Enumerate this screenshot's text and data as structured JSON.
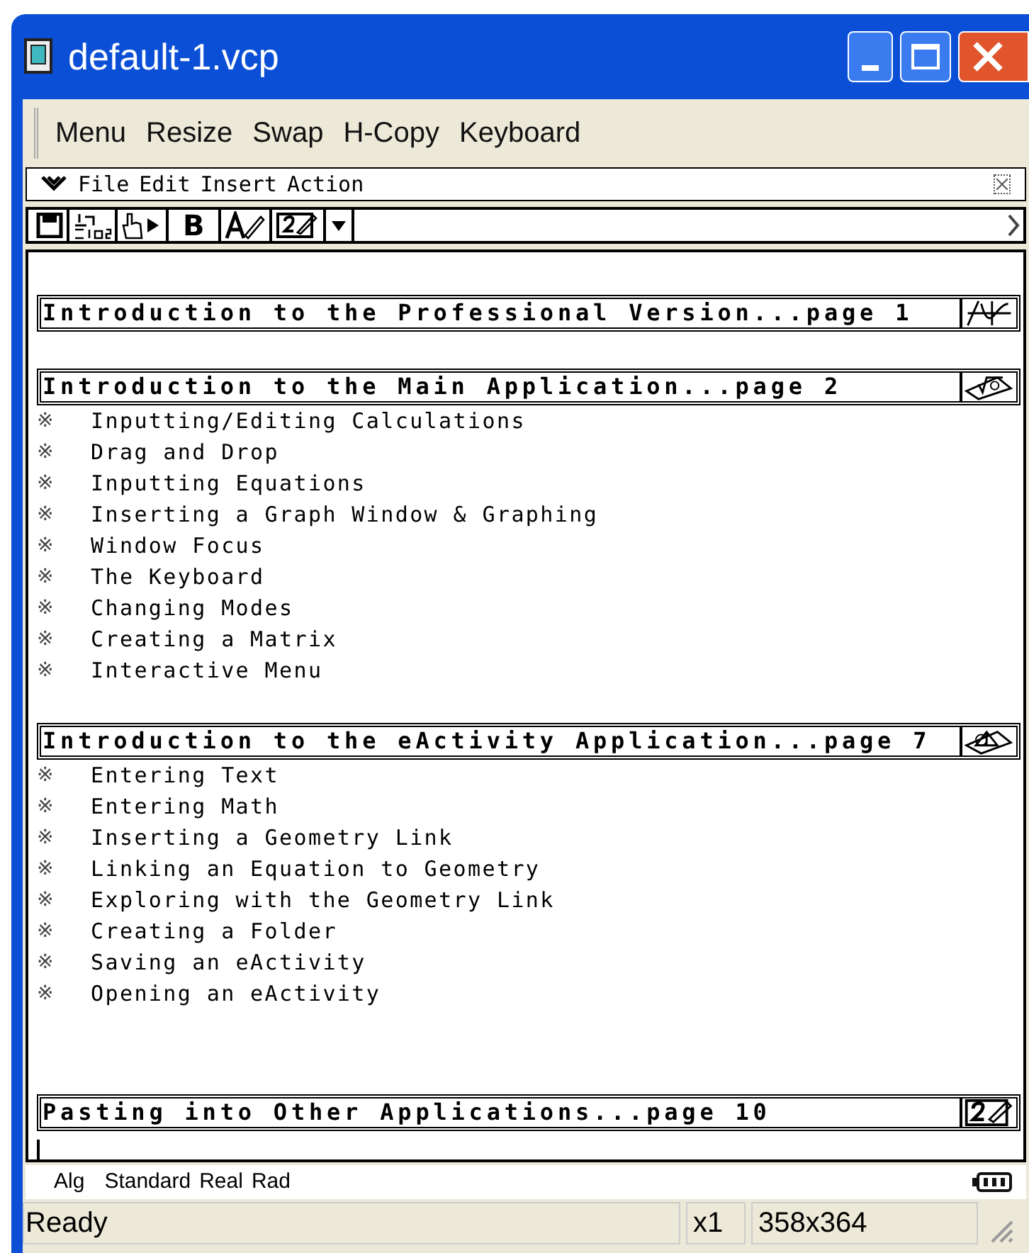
{
  "window": {
    "title": "default-1.vcp"
  },
  "menu_bar": [
    "Menu",
    "Resize",
    "Swap",
    "H-Copy",
    "Keyboard"
  ],
  "app_menu": {
    "items": [
      "File",
      "Edit",
      "Insert",
      "Action"
    ]
  },
  "toolbar": [
    {
      "kind": "save"
    },
    {
      "kind": "fraction"
    },
    {
      "kind": "run"
    },
    {
      "kind": "bold",
      "label": "B"
    },
    {
      "kind": "font"
    },
    {
      "kind": "edit"
    },
    {
      "kind": "dropdown"
    }
  ],
  "sections": [
    {
      "title": "Introduction to the Professional Version...page 1"
    },
    {
      "title": "Introduction to the Main Application...page 2",
      "items": [
        "Inputting/Editing Calculations",
        "Drag and Drop",
        "Inputting Equations",
        "Inserting a Graph Window & Graphing",
        "Window Focus",
        "The Keyboard",
        "Changing Modes",
        "Creating a Matrix",
        "Interactive Menu"
      ]
    },
    {
      "title": "Introduction to the eActivity Application...page 7",
      "items": [
        "Entering Text",
        "Entering Math",
        "Inserting a Geometry Link",
        "Linking an Equation to Geometry",
        "Exploring with the Geometry Link",
        "Creating a Folder",
        "Saving an eActivity",
        "Opening an eActivity"
      ]
    },
    {
      "title": "Pasting into Other Applications...page 10"
    }
  ],
  "bullet": "※",
  "mode_line": [
    "Alg",
    "Standard",
    "Real",
    "Rad"
  ],
  "status_bar": {
    "message": "Ready",
    "zoom": "x1",
    "size": "358x364"
  }
}
